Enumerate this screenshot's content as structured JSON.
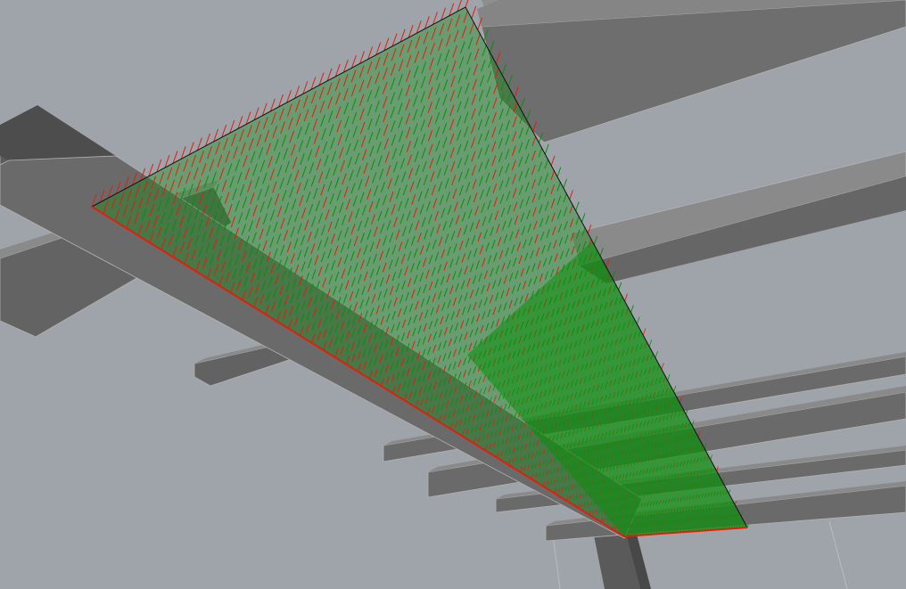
{
  "scene": {
    "description": "",
    "colors": {
      "background": "#9ea4aa",
      "beam_top": "#6c6c6c",
      "beam_side": "#545454",
      "beam_light": "#8e8e8e",
      "edge": "#b3b3b3",
      "mesh_green": "#0a8f0a",
      "mesh_red": "#e21e0a",
      "outline": "#111111"
    },
    "beams": [
      "beam-upper-right",
      "beam-mid-right",
      "beam-left-cross",
      "beam-diagonal",
      "beam-stub-left",
      "beam-lower-1",
      "beam-lower-2",
      "beam-lower-3",
      "beam-lower-4",
      "column"
    ],
    "mesh_label": "load-vector-field"
  }
}
